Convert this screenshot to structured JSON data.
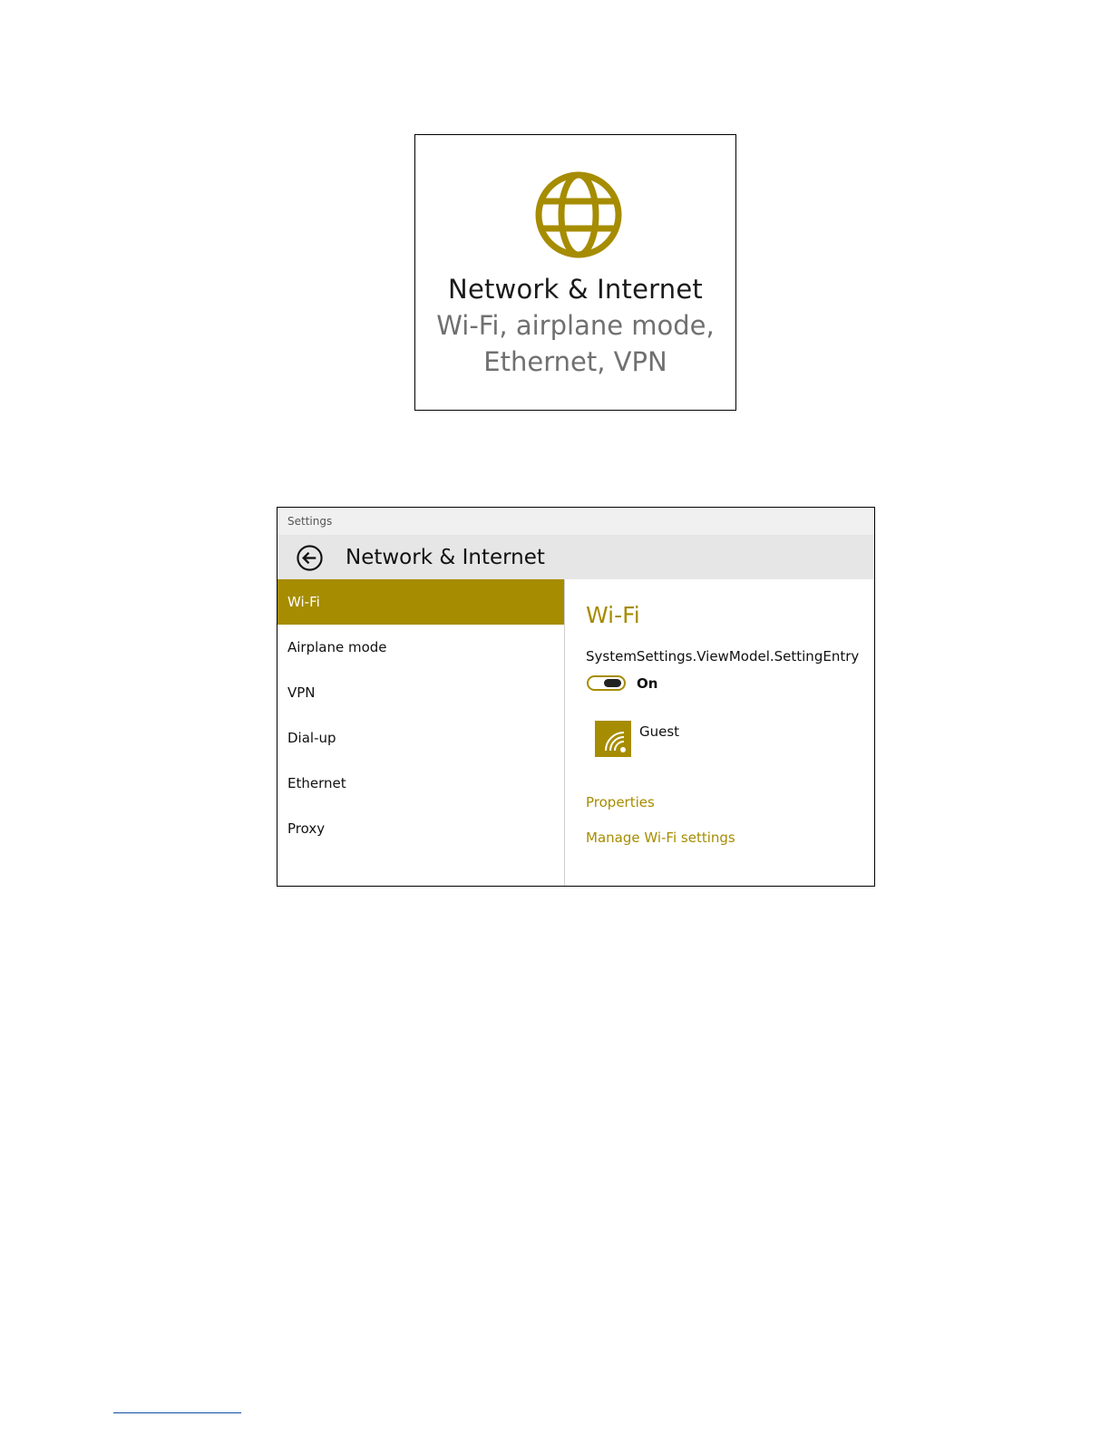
{
  "tile": {
    "icon": "globe-icon",
    "title": "Network & Internet",
    "subtitle_line1": "Wi-Fi, airplane mode,",
    "subtitle_line2": "Ethernet, VPN"
  },
  "window": {
    "title": "Settings",
    "header_title": "Network & Internet",
    "back_icon": "back-arrow-icon",
    "nav": [
      {
        "label": "Wi-Fi",
        "active": true
      },
      {
        "label": "Airplane mode",
        "active": false
      },
      {
        "label": "VPN",
        "active": false
      },
      {
        "label": "Dial-up",
        "active": false
      },
      {
        "label": "Ethernet",
        "active": false
      },
      {
        "label": "Proxy",
        "active": false
      }
    ],
    "content": {
      "title": "Wi-Fi",
      "setting_label": "SystemSettings.ViewModel.SettingEntry",
      "toggle_state": "On",
      "network_icon": "wifi-icon",
      "network_name": "Guest",
      "properties_link": "Properties",
      "manage_link": "Manage Wi-Fi settings"
    }
  },
  "colors": {
    "accent": "#a68c00",
    "header_bg": "#e6e6e6",
    "titlebar_bg": "#f0f0f0",
    "subtitle_text": "#707070"
  }
}
